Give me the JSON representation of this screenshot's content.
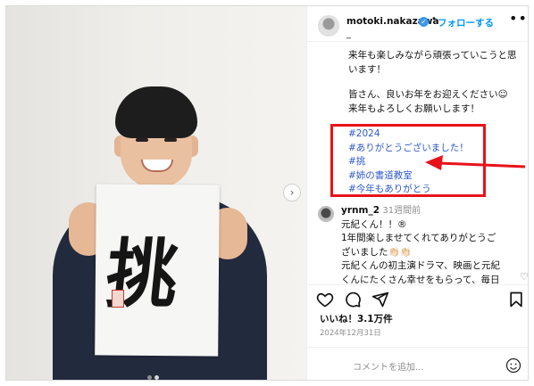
{
  "post": {
    "header": {
      "username": "motoki.nakazawa",
      "verified_icon": "verified-badge-icon",
      "separator": "•",
      "follow_label": "フォローする",
      "more_label": "•••",
      "sub_label": "_"
    },
    "caption": {
      "lines": [
        "来年も楽しみながら頑張っていこうと思",
        "います！",
        "皆さん、良いお年をお迎えください☺",
        "来年もよろしくお願いします！"
      ],
      "hashtags": [
        "#2024",
        "#ありがとうございました！",
        "#挑",
        "#姉の書道教室",
        "#今年もありがとう"
      ]
    },
    "comment": {
      "username": "yrnm_2",
      "time": "31週間前",
      "lines": [
        "元紀くん！！®",
        "1年間楽しませてくれてありがとうご",
        "ざいました👏🏻👏🏻",
        "元紀くんの初主演ドラマ、映画と元紀",
        "くんにたくさん幸せをもらって、毎日"
      ]
    },
    "photo": {
      "calligraphy": "挑",
      "carousel_next": "›"
    },
    "likes": "いいね！3.1万件",
    "date": "2024年12月31日",
    "add_comment_placeholder": "コメントを追加...",
    "colors": {
      "link": "#0095f6",
      "hashtag": "#2c59c9",
      "annotation": "#e8121b"
    }
  }
}
